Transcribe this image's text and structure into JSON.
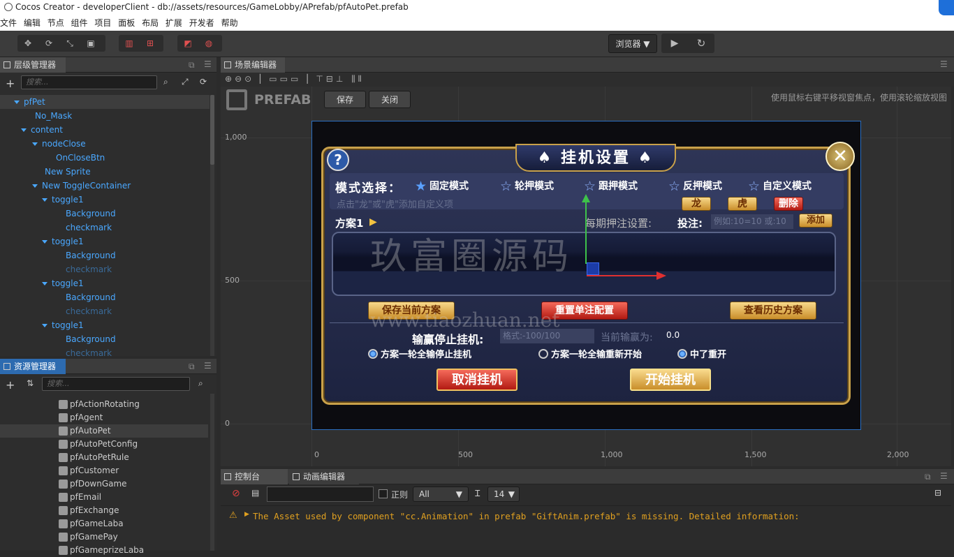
{
  "window": {
    "title": "Cocos Creator - developerClient - db://assets/resources/GameLobby/APrefab/pfAutoPet.prefab"
  },
  "menu": [
    "文件",
    "编辑",
    "节点",
    "组件",
    "项目",
    "面板",
    "布局",
    "扩展",
    "开发者",
    "帮助"
  ],
  "toolbar": {
    "browser_label": "浏览器 ▼",
    "play_icon": "play-icon",
    "refresh_icon": "refresh-icon"
  },
  "hierarchy": {
    "title": "层级管理器",
    "search_placeholder": "搜索...",
    "items": [
      {
        "label": "pfPet",
        "arrow": true
      },
      {
        "label": "No_Mask",
        "arrow": false
      },
      {
        "label": "content",
        "arrow": true
      },
      {
        "label": "nodeClose",
        "arrow": true
      },
      {
        "label": "OnCloseBtn",
        "arrow": false
      },
      {
        "label": "New Sprite",
        "arrow": false
      },
      {
        "label": "New ToggleContainer",
        "arrow": true
      },
      {
        "label": "toggle1",
        "arrow": true
      },
      {
        "label": "Background",
        "arrow": false
      },
      {
        "label": "checkmark",
        "arrow": false
      },
      {
        "label": "toggle1",
        "arrow": true
      },
      {
        "label": "Background",
        "arrow": false
      },
      {
        "label": "checkmark",
        "arrow": false,
        "dim": true
      },
      {
        "label": "toggle1",
        "arrow": true
      },
      {
        "label": "Background",
        "arrow": false
      },
      {
        "label": "checkmark",
        "arrow": false,
        "dim": true
      },
      {
        "label": "toggle1",
        "arrow": true
      },
      {
        "label": "Background",
        "arrow": false
      },
      {
        "label": "checkmark",
        "arrow": false,
        "dim": true
      }
    ]
  },
  "assets": {
    "title": "资源管理器",
    "search_placeholder": "搜索...",
    "items": [
      "pfActionRotating",
      "pfAgent",
      "pfAutoPet",
      "pfAutoPetConfig",
      "pfAutoPetRule",
      "pfCustomer",
      "pfDownGame",
      "pfEmail",
      "pfExchange",
      "pfGameLaba",
      "pfGamePay",
      "pfGameprizeLaba"
    ],
    "selected": "pfAutoPet"
  },
  "scene": {
    "title": "场景编辑器",
    "prefab_label": "PREFAB",
    "save_label": "保存",
    "close_label": "关闭",
    "hint": "使用鼠标右键平移视窗焦点，使用滚轮缩放视图",
    "y_labels": [
      "1,000",
      "500",
      "0"
    ],
    "x_labels": [
      "0",
      "500",
      "1,000",
      "1,500",
      "2,000"
    ]
  },
  "dialog": {
    "title": "挂机设置",
    "mode_label": "模式选择：",
    "modes": [
      "固定模式",
      "轮押模式",
      "跟押模式",
      "反押模式",
      "自定义模式"
    ],
    "hint": "点击\"龙\"或\"虎\"添加自定义项",
    "dragon": "龙",
    "tiger": "虎",
    "delete": "删除",
    "plan_label": "方案1",
    "bet_setting_label": "每期押注设置:",
    "bet_label": "投注:",
    "bet_placeholder": "例如:10=10 或:10",
    "add_label": "添加",
    "save_plan": "保存当前方案",
    "reset_config": "重置单注配置",
    "view_history": "查看历史方案",
    "stop_label": "输赢停止挂机:",
    "stop_placeholder": "格式:-100/100",
    "current_label": "当前输赢为:",
    "current_value": "0.0",
    "options": [
      "方案一轮全输停止挂机",
      "方案一轮全输重新开始",
      "中了重开"
    ],
    "cancel": "取消挂机",
    "start": "开始挂机",
    "watermark1": "玖富圈源码",
    "watermark2": "www.tiaozhuan.net"
  },
  "console": {
    "tab1": "控制台",
    "tab2": "动画编辑器",
    "regex_label": "正则",
    "filter_value": "All",
    "font_size": "14",
    "message": "The Asset used by component \"cc.Animation\" in prefab \"GiftAnim.prefab\" is missing. Detailed information:"
  }
}
